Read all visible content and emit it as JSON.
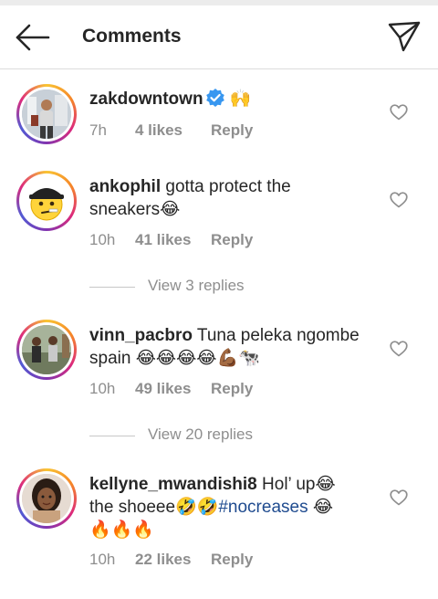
{
  "header": {
    "title": "Comments",
    "back_icon": "arrow-left-icon",
    "send_icon": "paper-plane-icon"
  },
  "comments": [
    {
      "username": "zakdowntown",
      "verified": true,
      "text": "",
      "emojis": "🙌",
      "time": "7h",
      "likes": "4 likes",
      "reply": "Reply"
    },
    {
      "username": "ankophil",
      "text": "gotta protect the sneakers",
      "emojis": "😂",
      "time": "10h",
      "likes": "41 likes",
      "reply": "Reply",
      "view_replies": "View 3 replies"
    },
    {
      "username": "vinn_pacbro",
      "text": "Tuna peleka ngombe spain",
      "emojis": "😂😂😂😂💪🏾🐄",
      "time": "10h",
      "likes": "49 likes",
      "reply": "Reply",
      "view_replies": "View 20 replies"
    },
    {
      "username": "kellyne_mwandishi8",
      "text_a": "Hol’ up",
      "emoji_a": "😂",
      "text_b": "the shoeee",
      "emoji_b": "🤣🤣",
      "hashtag": "#nocreases",
      "emoji_c": "😂",
      "emoji_d": "🔥🔥🔥",
      "time": "10h",
      "likes": "22 likes",
      "reply": "Reply"
    }
  ],
  "colors": {
    "verified_blue": "#3897f0",
    "hashtag_blue": "#1f4b8f",
    "meta_gray": "#8e8e8e"
  }
}
